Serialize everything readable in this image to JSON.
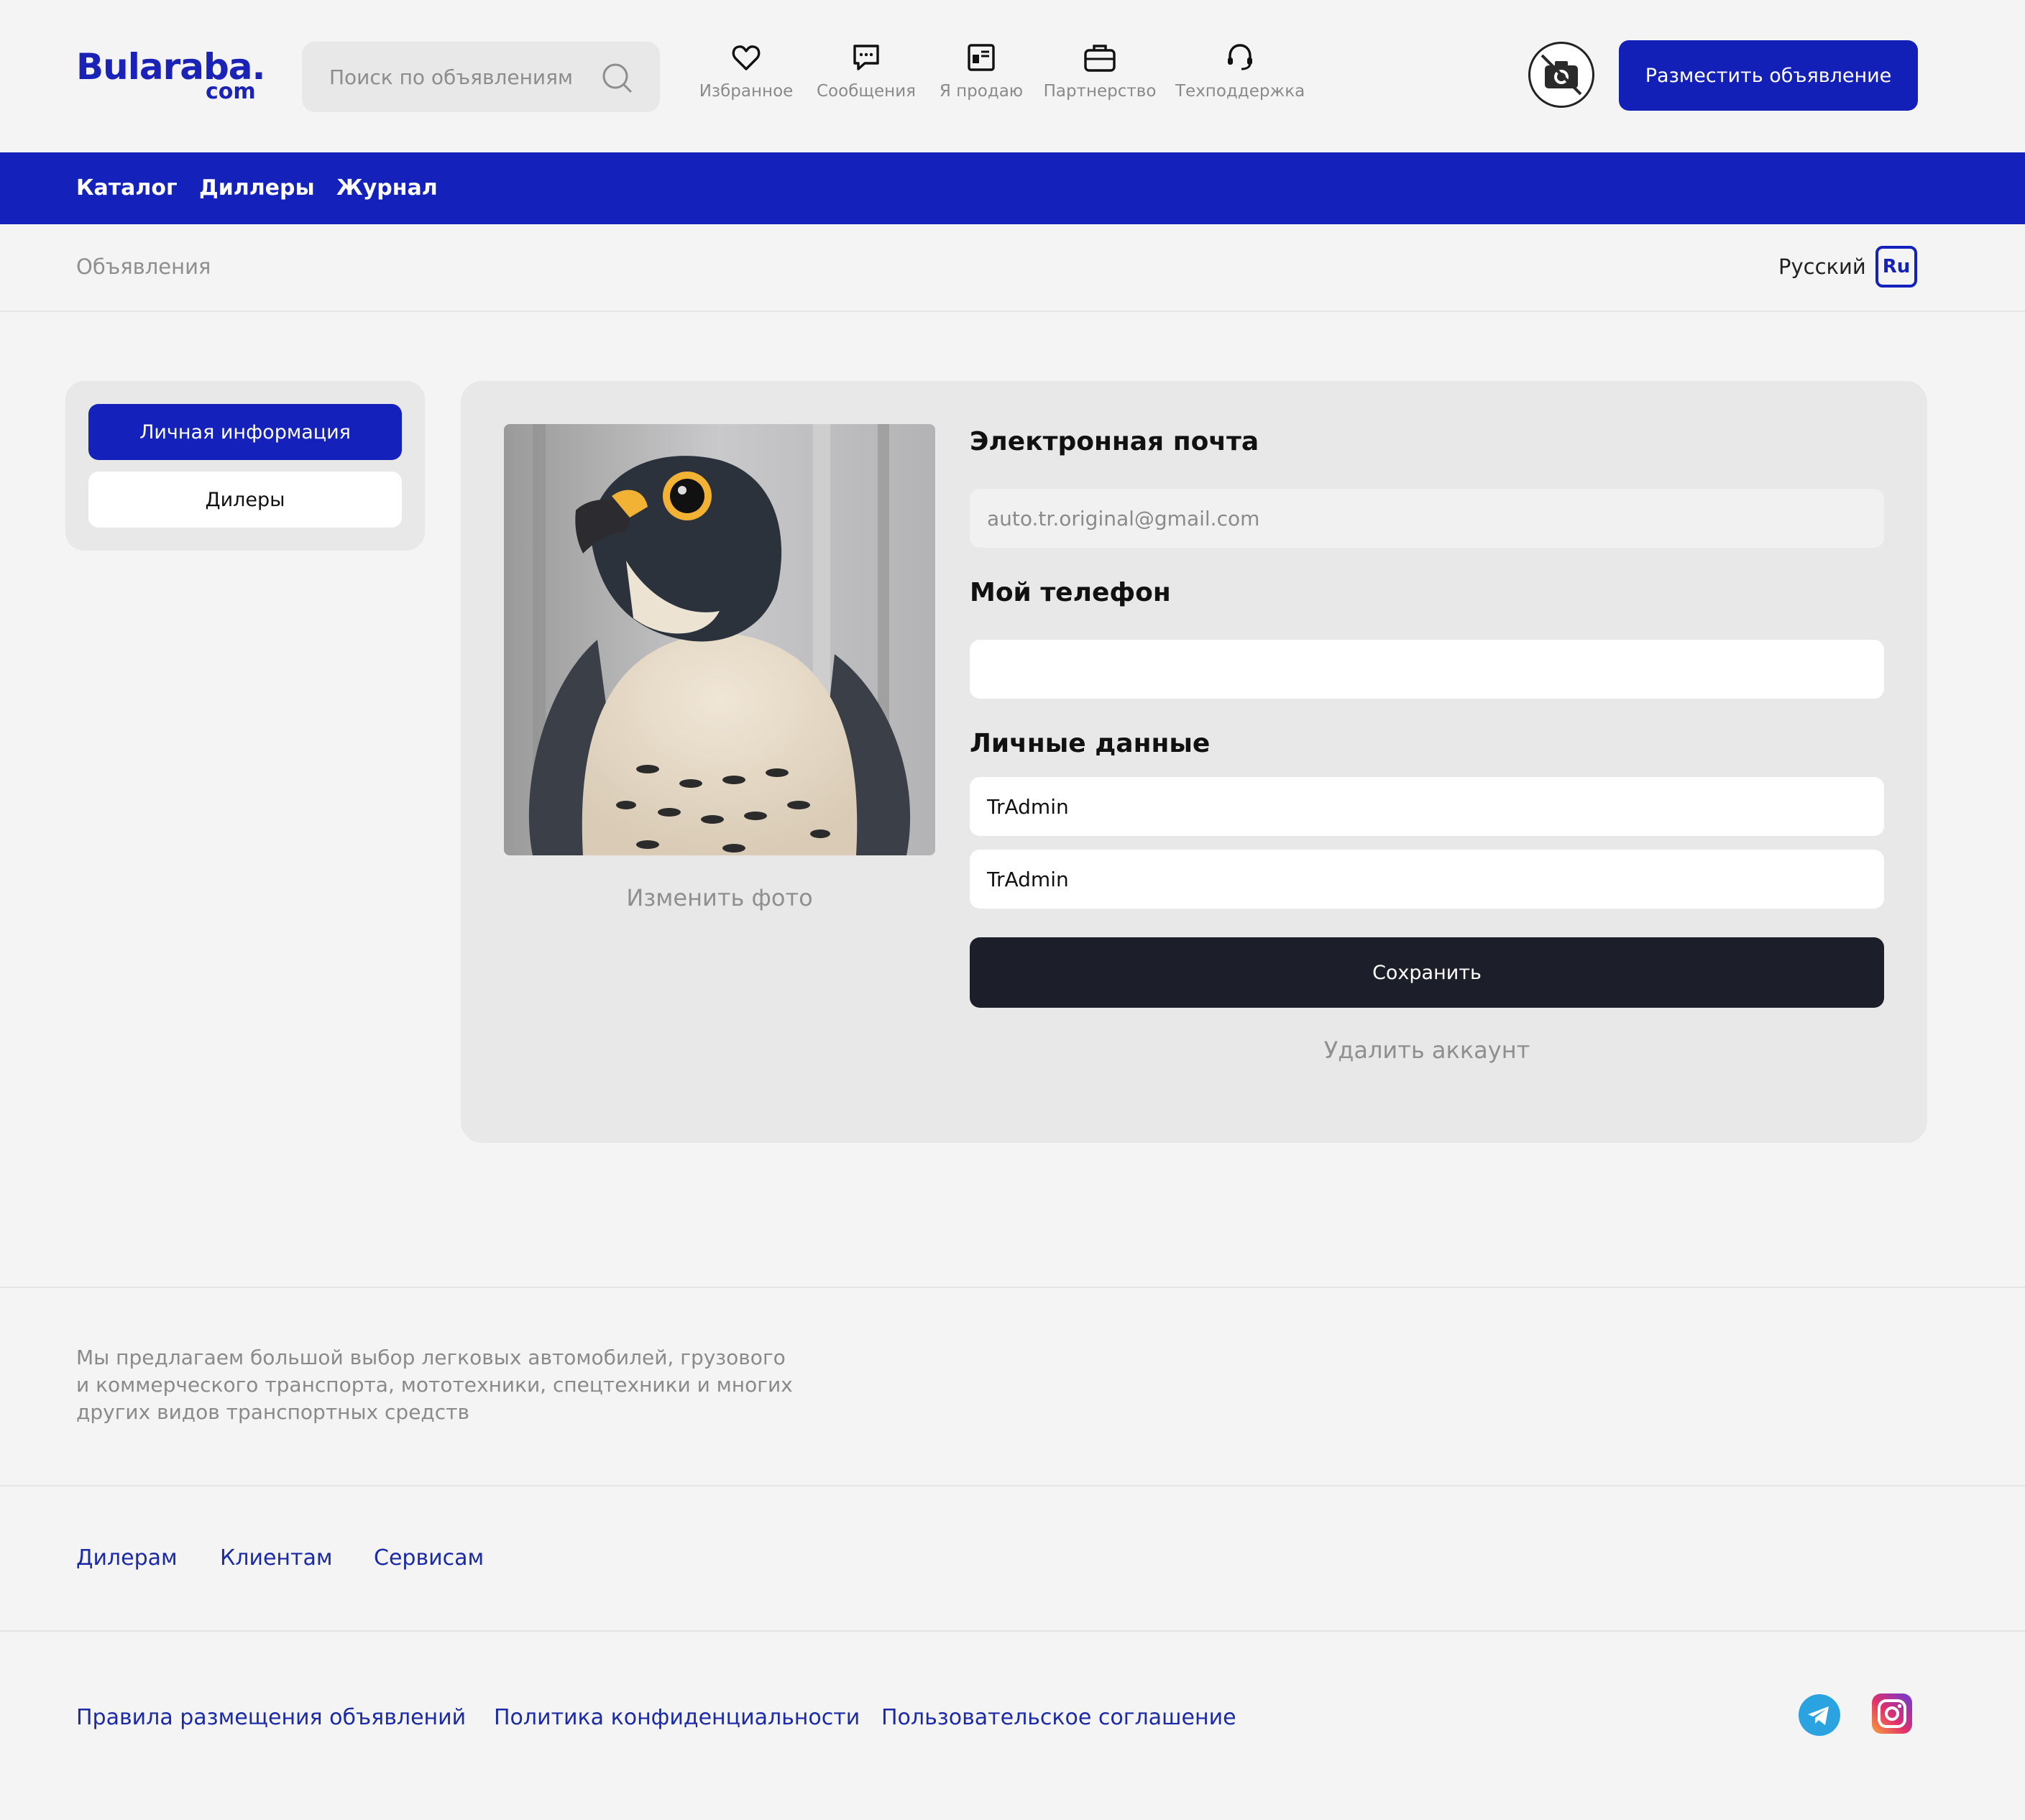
{
  "header": {
    "logo_main": "Bularaba.",
    "logo_sub": "com",
    "search_placeholder": "Поиск по объявлениям",
    "nav": [
      {
        "label": "Избранное",
        "icon": "heart-icon"
      },
      {
        "label": "Сообщения",
        "icon": "chat-icon"
      },
      {
        "label": "Я продаю",
        "icon": "listing-icon"
      },
      {
        "label": "Партнерство",
        "icon": "briefcase-icon"
      },
      {
        "label": "Техподдержка",
        "icon": "headset-icon"
      }
    ],
    "post_button": "Разместить объявление"
  },
  "topnav": [
    "Каталог",
    "Диллеры",
    "Журнал"
  ],
  "breadcrumb": "Объявления",
  "language": {
    "label": "Русский",
    "code": "Ru"
  },
  "sidebar": {
    "items": [
      {
        "label": "Личная информация",
        "active": true
      },
      {
        "label": "Дилеры",
        "active": false
      }
    ]
  },
  "profile": {
    "change_photo": "Изменить фото",
    "email_title": "Электронная почта",
    "email_value": "auto.tr.original@gmail.com",
    "phone_title": "Мой телефон",
    "phone_value": "",
    "personal_title": "Личные данные",
    "first_name": "TrAdmin",
    "last_name": "TrAdmin",
    "save_button": "Сохранить",
    "delete_link": "Удалить аккаунт"
  },
  "footer": {
    "description": "Мы предлагаем большой выбор легковых автомобилей, грузового и коммерческого транспорта, мототехники, спецтехники и многих других видов транспортных средств",
    "links_row1": [
      "Дилерам",
      "Клиентам",
      "Сервисам"
    ],
    "links_row2": [
      "Правила размещения объявлений",
      "Политика конфиденциальности",
      "Пользовательское соглашение"
    ]
  },
  "colors": {
    "brand": "#1422bb",
    "dark_button": "#1c1e29",
    "muted_text": "#8f8f8f"
  }
}
